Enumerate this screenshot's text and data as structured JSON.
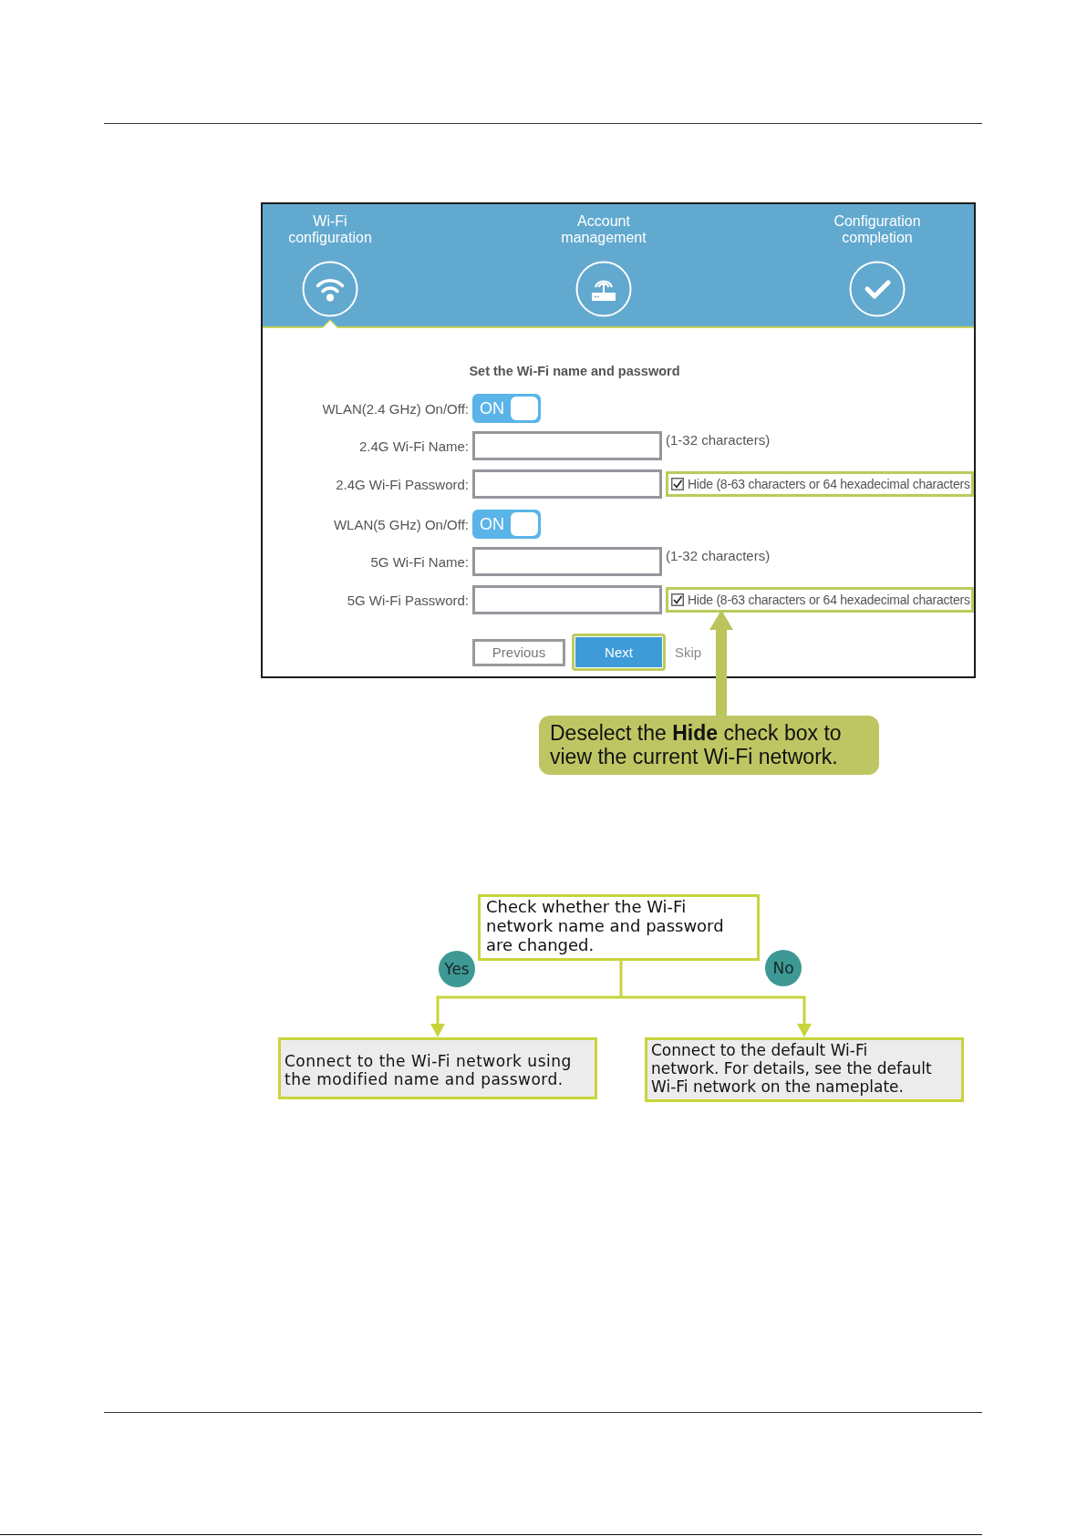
{
  "wizard": {
    "steps": [
      {
        "label": "Wi-Fi configuration",
        "selected": true
      },
      {
        "label": "Account management",
        "selected": false
      },
      {
        "label": "Configuration completion",
        "selected": false
      }
    ],
    "form": {
      "title": "Set the Wi-Fi name and password",
      "rows": [
        {
          "kind": "toggle",
          "label": "WLAN(2.4 GHz) On/Off:",
          "toggle_text": "ON",
          "on": true
        },
        {
          "kind": "text",
          "label": "2.4G Wi-Fi Name:",
          "hint": "(1-32 characters)"
        },
        {
          "kind": "password",
          "label": "2.4G Wi-Fi Password:",
          "checkbox": {
            "label": "Hide (8-63 characters or 64 hexadecimal characters",
            "checked": true,
            "highlighted": true
          }
        },
        {
          "kind": "toggle",
          "label": "WLAN(5 GHz) On/Off:",
          "toggle_text": "ON",
          "on": true
        },
        {
          "kind": "text",
          "label": "5G Wi-Fi Name:",
          "hint": "(1-32 characters)"
        },
        {
          "kind": "password",
          "label": "5G Wi-Fi Password:",
          "checkbox": {
            "label": "Hide (8-63 characters or 64 hexadecimal characters",
            "checked": true,
            "highlighted": true
          }
        }
      ],
      "buttons": [
        {
          "kind": "secondary",
          "label": "Previous",
          "highlighted": false
        },
        {
          "kind": "primary",
          "label": "Next",
          "highlighted": true
        },
        {
          "kind": "link",
          "label": "Skip",
          "highlighted": false
        }
      ]
    }
  },
  "callout": {
    "text": "Deselect the **Hide** check box to view the current Wi-Fi network."
  },
  "flowchart": {
    "question": "Check whether the Wi-Fi network name and password are changed.",
    "branches": [
      {
        "label": "Yes",
        "result": "Connect to the Wi-Fi network using the modified name and password."
      },
      {
        "label": "No",
        "result": "Connect to the default Wi-Fi network. For details, see the default Wi-Fi network on the nameplate."
      }
    ]
  }
}
